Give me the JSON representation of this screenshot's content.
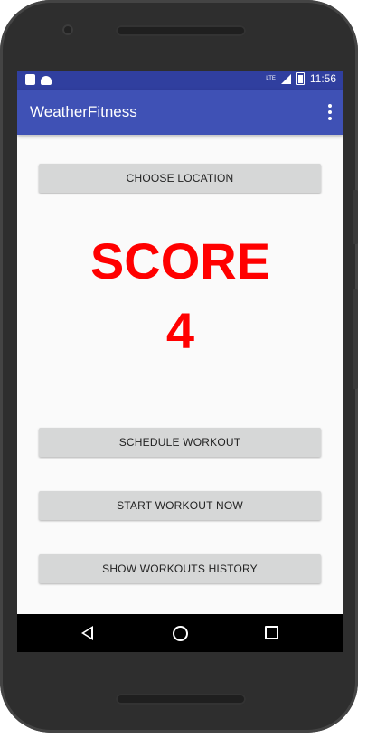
{
  "status_bar": {
    "network": "LTE",
    "time": "11:56"
  },
  "app_bar": {
    "title": "WeatherFitness",
    "menu_icon": "more-vert-icon"
  },
  "main": {
    "choose_location_label": "CHOOSE LOCATION",
    "score_label": "SCORE",
    "score_value": "4",
    "score_color": "#ff0000",
    "schedule_workout_label": "SCHEDULE WORKOUT",
    "start_workout_label": "START WORKOUT NOW",
    "show_history_label": "SHOW WORKOUTS HISTORY"
  },
  "nav_bar": {
    "back_icon": "back-icon",
    "home_icon": "home-icon",
    "recents_icon": "recents-icon"
  },
  "colors": {
    "status_bar": "#303f9f",
    "app_bar": "#3f51b5",
    "button": "#d6d7d7"
  }
}
